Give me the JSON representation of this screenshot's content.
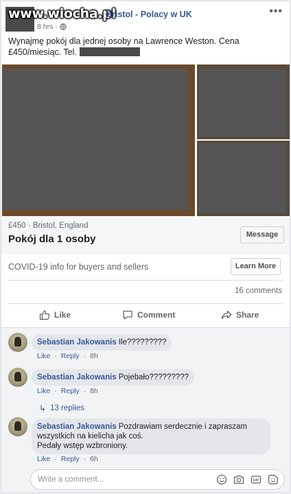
{
  "watermark": "www.wiocha.pl",
  "post": {
    "group": "Bristol - Polacy w UK",
    "time": "8 hrs ·",
    "text": "Wynajmę pokój dla jednej osoby na Lawrence Weston. Cena £450/miesiąc. Tel."
  },
  "listing": {
    "price_location": "£450 · Bristol, England",
    "title": "Pokój dla 1 osoby",
    "message_label": "Message"
  },
  "covid": {
    "text": "COVID-19 info for buyers and sellers",
    "button": "Learn More"
  },
  "comments_count": "16 comments",
  "actions": {
    "like": "Like",
    "comment": "Comment",
    "share": "Share"
  },
  "comments": [
    {
      "author": "Sebastian Jakowanis",
      "text": "Ile?????????",
      "like": "Like",
      "reply": "Reply",
      "time": "8h"
    },
    {
      "author": "Sebastian Jakowanis",
      "text": "Pojebało?????????",
      "like": "Like",
      "reply": "Reply",
      "time": "8h"
    },
    {
      "author": "Sebastian Jakowanis",
      "text_line1": "Pozdrawiam serdecznie i zapraszam",
      "text_line2": "wszystkich na kielicha jak coś.",
      "text_line3": "Pedały wstęp wzbroniony.",
      "like": "Like",
      "reply": "Reply",
      "time": "6h"
    }
  ],
  "replies_label": "13 replies",
  "comment_input": {
    "placeholder": "Write a comment..."
  },
  "colors": {
    "link": "#385898",
    "muted": "#606770",
    "bg": "#e9ebee"
  }
}
